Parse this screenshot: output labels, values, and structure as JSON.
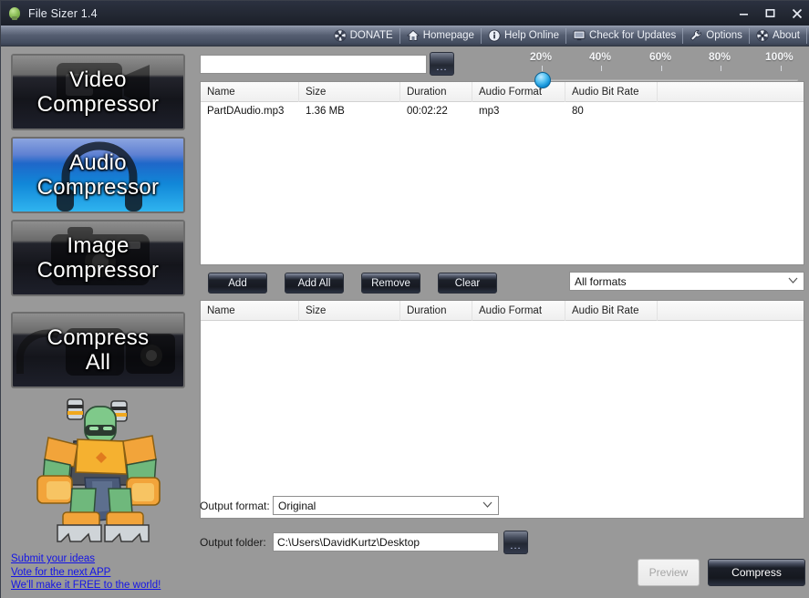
{
  "window": {
    "title": "File Sizer 1.4",
    "app_icon": "lightbulb-icon",
    "minimize_label": "Minimize",
    "maximize_label": "Maximize",
    "close_label": "Close"
  },
  "toolbar": {
    "items": [
      {
        "label": "DONATE",
        "icon": "shutter-icon"
      },
      {
        "label": "Homepage",
        "icon": "home-icon"
      },
      {
        "label": "Help Online",
        "icon": "info-icon"
      },
      {
        "label": "Check for Updates",
        "icon": "monitor-icon"
      },
      {
        "label": "Options",
        "icon": "wrench-icon"
      },
      {
        "label": "About",
        "icon": "shutter-icon"
      }
    ]
  },
  "sidebar": {
    "buttons": [
      {
        "line1": "Video",
        "line2": "Compressor",
        "selected": false,
        "art": "video-camera-art"
      },
      {
        "line1": "Audio",
        "line2": "Compressor",
        "selected": true,
        "art": "headphones-art"
      },
      {
        "line1": "Image",
        "line2": "Compressor",
        "selected": false,
        "art": "camera-art"
      },
      {
        "line1": "Compress",
        "line2": "All",
        "selected": false,
        "art": "all-media-art"
      }
    ],
    "mascot_alt": "robot-mascot",
    "links": [
      "Submit your ideas",
      "Vote for the next APP",
      "We'll make it FREE to the world!"
    ]
  },
  "main": {
    "path_input": {
      "value": "",
      "placeholder": ""
    },
    "browse_button_label": "...",
    "source_list": {
      "columns": [
        "Name",
        "Size",
        "Duration",
        "Audio Format",
        "Audio Bit Rate"
      ],
      "rows": [
        {
          "name": "PartDAudio.mp3",
          "size": "1.36 MB",
          "duration": "00:02:22",
          "audio_format": "mp3",
          "audio_bit_rate": "80"
        }
      ]
    },
    "actions": {
      "add": "Add",
      "add_all": "Add All",
      "remove": "Remove",
      "clear": "Clear"
    },
    "format_filter": {
      "selected": "All formats"
    },
    "target_list": {
      "columns": [
        "Name",
        "Size",
        "Duration",
        "Audio Format",
        "Audio Bit Rate"
      ],
      "rows": []
    },
    "output_format": {
      "label": "Output format:",
      "selected": "Original"
    },
    "output_folder": {
      "label": "Output folder:",
      "value": "C:\\Users\\DavidKurtz\\Desktop",
      "browse_label": "..."
    },
    "quality_slider": {
      "ticks": [
        "20%",
        "40%",
        "60%",
        "80%",
        "100%"
      ],
      "value": 20
    },
    "preview_button": {
      "label": "Preview",
      "enabled": false
    },
    "compress_button": {
      "label": "Compress",
      "enabled": true
    }
  },
  "colors": {
    "window_chrome": "#232833",
    "toolbar": "#545d70",
    "panel_bg": "#999999",
    "accent_blue": "#1f67c9",
    "link_blue": "#1414e6",
    "slider_thumb": "#0f8fd6"
  }
}
